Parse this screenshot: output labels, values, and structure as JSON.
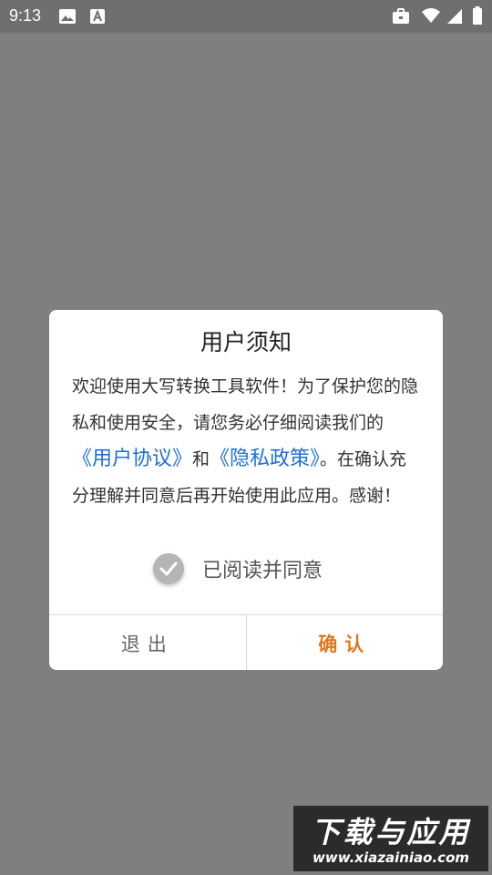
{
  "status_bar": {
    "time": "9:13",
    "left_icons": [
      "image-icon",
      "a-icon"
    ],
    "right_icons": [
      "briefcase-icon",
      "wifi-icon",
      "signal-icon",
      "battery-icon"
    ]
  },
  "dialog": {
    "title": "用户须知",
    "message": {
      "part1": "欢迎使用大写转换工具软件！为了保护您的隐私和使用安全，请您务必仔细阅读我们的",
      "user_agreement_link": "《用户协议》",
      "and": "和",
      "privacy_policy_link": "《隐私政策》",
      "part2": "。在确认充分理解并同意后再开始使用此应用。感谢！"
    },
    "agree_label": "已阅读并同意",
    "agree_checked": true,
    "buttons": {
      "exit_label": "退出",
      "confirm_label": "确认"
    },
    "colors": {
      "link": "#1f6fd4",
      "confirm": "#e0781e",
      "overlay": "#7f7f7f"
    }
  },
  "watermark": {
    "title": "下载与应用",
    "url": "www.xiazainiao.com"
  }
}
